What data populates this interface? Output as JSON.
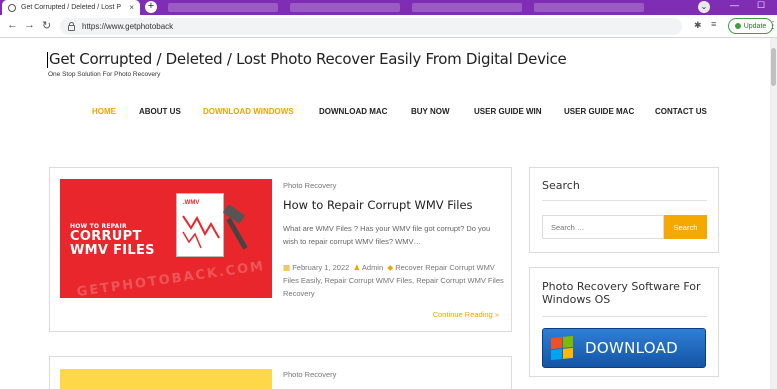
{
  "browser": {
    "active_tab_title": "Get Corrupted / Deleted / Lost P",
    "tab_close": "×",
    "new_tab": "+",
    "url": "https://www.getphotoback",
    "update_label": "Update",
    "tab_list": "⌄",
    "minimize": "—",
    "maximize": "☐"
  },
  "site": {
    "title": "Get Corrupted / Deleted / Lost Photo Recover Easily From Digital Device",
    "tagline": "One Stop Solution For Photo Recovery"
  },
  "nav": [
    "HOME",
    "ABOUT US",
    "DOWNLOAD WINDOWS",
    "DOWNLOAD MAC",
    "BUY NOW",
    "USER GUIDE WIN",
    "USER GUIDE MAC",
    "CONTACT US"
  ],
  "nav_active": [
    "HOME",
    "DOWNLOAD WINDOWS"
  ],
  "post": {
    "category": "Photo Recovery",
    "title": "How to Repair Corrupt WMV Files",
    "excerpt": "What are WMV Files ? Has your WMV file got corrupt? Do you wish to repair corrupt WMV files? WMV…",
    "date": "February 1, 2022",
    "author": "Admin",
    "tags": "Recover Repair Corrupt WMV Files Easily, Repair Corrupt WMV Files, Repair Corrupt WMV Files Recovery",
    "continue": "Continue Reading »",
    "thumb_small": "HOW TO REPAIR",
    "thumb_big1": "CORRUPT",
    "thumb_big2": "WMV FILES",
    "thumb_doc": ".WMV",
    "thumb_watermark": "GETPHOTOBACK.COM"
  },
  "post2": {
    "category": "Photo Recovery"
  },
  "sidebar": {
    "search_title": "Search",
    "search_placeholder": "Search …",
    "search_button": "Search",
    "software_title": "Photo Recovery Software For Windows OS",
    "download_label": "DOWNLOAD"
  },
  "colors": {
    "accent": "#f0a400",
    "tab_bar": "#7f2db5",
    "thumb_red": "#e8262b"
  }
}
